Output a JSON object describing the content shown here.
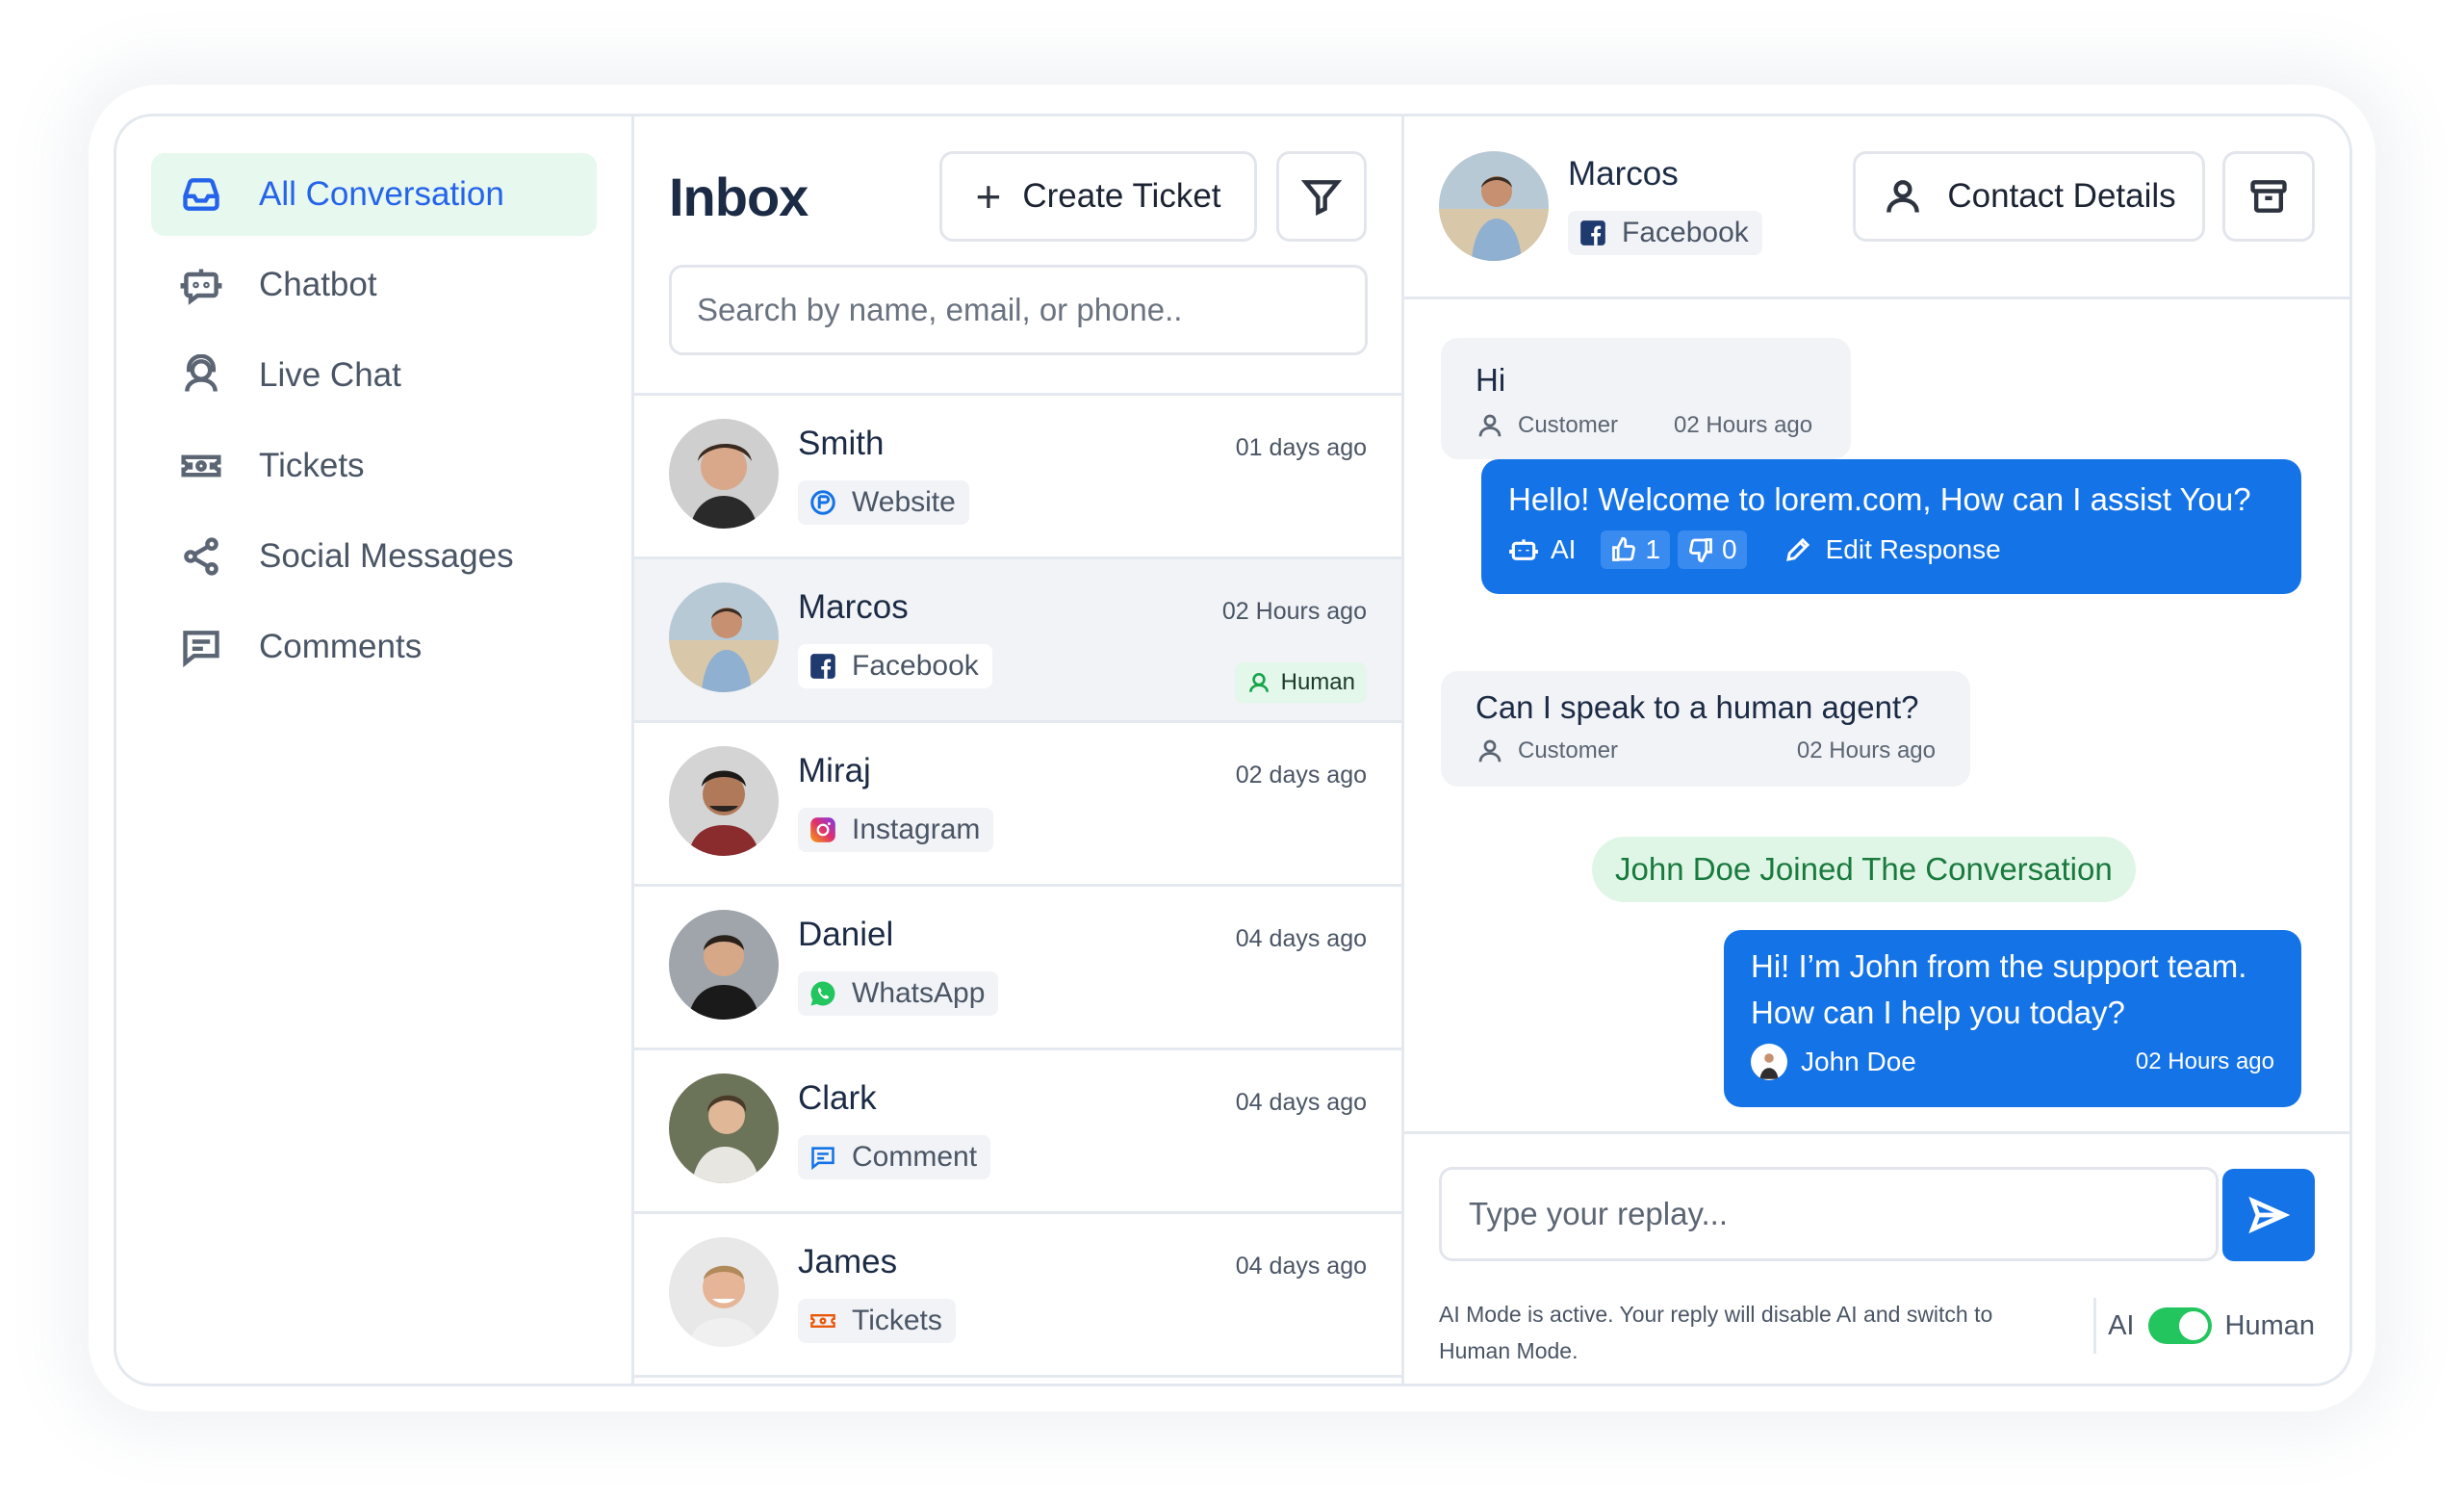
{
  "sidebar": {
    "items": [
      {
        "label": "All Conversation",
        "icon": "inbox-icon"
      },
      {
        "label": "Chatbot",
        "icon": "chatbot-icon"
      },
      {
        "label": "Live Chat",
        "icon": "agent-icon"
      },
      {
        "label": "Tickets",
        "icon": "ticket-icon"
      },
      {
        "label": "Social Messages",
        "icon": "share-icon"
      },
      {
        "label": "Comments",
        "icon": "comment-icon"
      }
    ]
  },
  "inbox": {
    "title": "Inbox",
    "create_ticket_label": "Create Ticket",
    "search_placeholder": "Search by name, email, or phone..",
    "conversations": [
      {
        "name": "Smith",
        "time": "01 days ago",
        "channel": "Website"
      },
      {
        "name": "Marcos",
        "time": "02 Hours ago",
        "channel": "Facebook",
        "badge": "Human"
      },
      {
        "name": "Miraj",
        "time": "02 days ago",
        "channel": "Instagram"
      },
      {
        "name": "Daniel",
        "time": "04 days ago",
        "channel": "WhatsApp"
      },
      {
        "name": "Clark",
        "time": "04 days ago",
        "channel": "Comment"
      },
      {
        "name": "James",
        "time": "04 days ago",
        "channel": "Tickets"
      }
    ]
  },
  "chat": {
    "contact_name": "Marcos",
    "contact_channel": "Facebook",
    "contact_details_label": "Contact Details",
    "messages": [
      {
        "text": "Hi",
        "role": "Customer",
        "time": "02 Hours ago"
      },
      {
        "text": "Hello! Welcome to lorem.com, How can I assist You?",
        "ai_label": "AI",
        "likes": "1",
        "dislikes": "0",
        "edit_label": "Edit Response"
      },
      {
        "text": "Can I speak to a human agent?",
        "role": "Customer",
        "time": "02 Hours ago"
      },
      {
        "system": "John Doe Joined The Conversation"
      },
      {
        "line1": "Hi! I’m John from the support team.",
        "line2": "How can I help you today?",
        "agent": "John Doe",
        "time": "02 Hours ago"
      }
    ],
    "reply_placeholder": "Type your replay...",
    "ai_notice": "AI Mode is active. Your reply will disable AI and switch to Human Mode.",
    "mode_left": "AI",
    "mode_right": "Human"
  },
  "colors": {
    "accent": "#1473e6",
    "active_nav_bg": "#e7f8ee",
    "active_nav_text": "#2563eb",
    "toggle_on": "#22c55e"
  }
}
